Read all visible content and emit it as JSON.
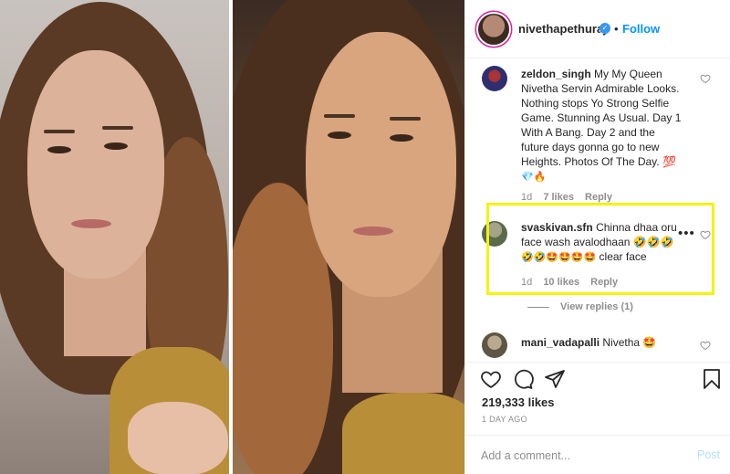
{
  "post": {
    "username": "nivethapethuraj",
    "separator": "•",
    "follow_label": "Follow",
    "verified_glyph": "✓"
  },
  "comments": [
    {
      "username": "zeldon_singh",
      "text": "My My Queen Nivetha Servin Admirable Looks. Nothing stops Yo Strong Selfie Game. Stunning As Usual. Day 1 With A Bang. Day 2 and the future days gonna go to new Heights. Photos Of The Day. 💯",
      "emoji_line": "💎🔥",
      "age": "1d",
      "likes": "7 likes",
      "reply_label": "Reply"
    },
    {
      "username": "svaskivan.sfn",
      "text": "Chinna dhaa oru face wash avalodhaan 🤣🤣🤣",
      "emoji_line": "🤣🤣🤩🤩🤩🤩",
      "suffix": "clear face",
      "age": "1d",
      "likes": "10 likes",
      "reply_label": "Reply",
      "more_label": "•••",
      "view_replies": "View replies (1)"
    },
    {
      "username": "mani_vadapalli",
      "text": "Nivetha 🤩"
    }
  ],
  "actions": {
    "likes_count": "219,333 likes",
    "time_ago": "1 DAY AGO"
  },
  "add_comment": {
    "placeholder": "Add a comment...",
    "post_label": "Post"
  },
  "colors": {
    "follow": "#0095f6",
    "highlight": "#f5f30b",
    "verified": "#3897f0",
    "muted": "#8e8e8e"
  },
  "icons": [
    "heart-icon",
    "comment-icon",
    "share-icon",
    "bookmark-icon",
    "verified-badge-icon",
    "more-options-icon"
  ]
}
